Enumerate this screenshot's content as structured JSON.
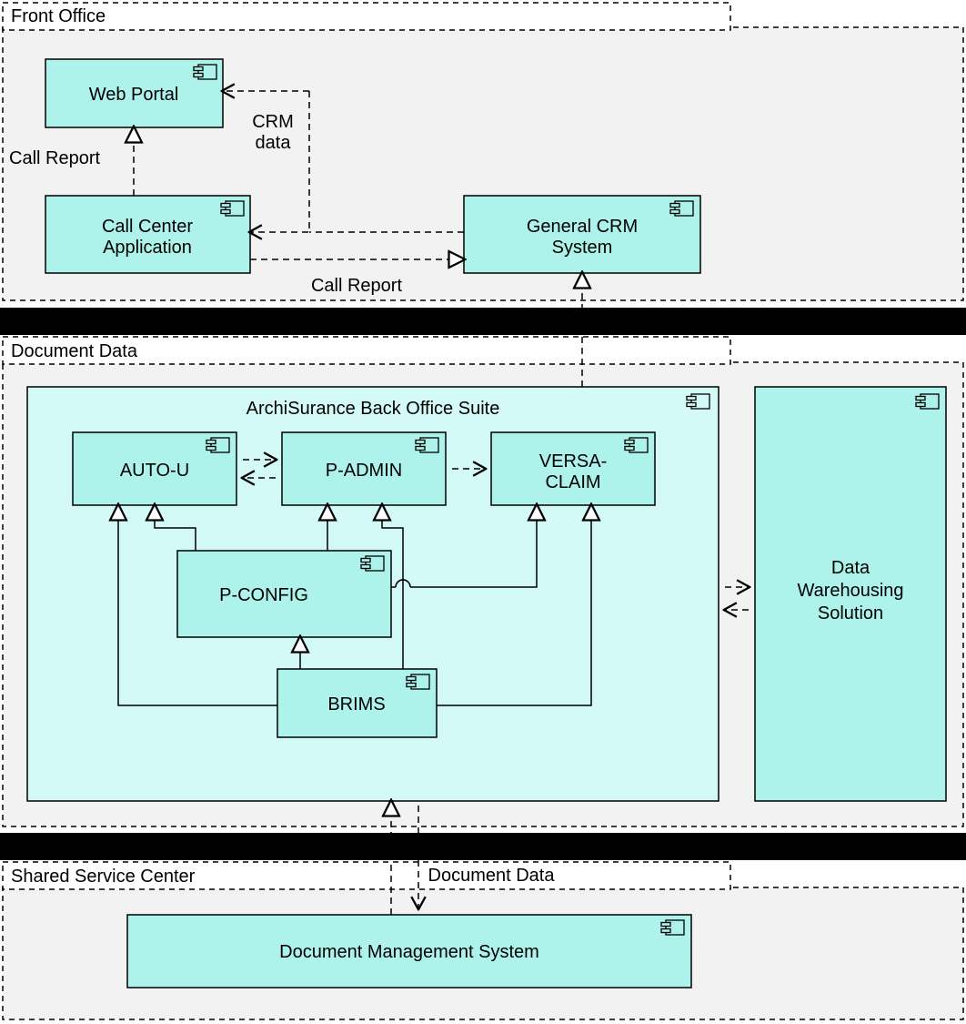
{
  "groups": {
    "front_office": "Front Office",
    "document_data": "Document Data",
    "shared_service_center": "Shared Service Center"
  },
  "components": {
    "web_portal": "Web Portal",
    "call_center_app_l1": "Call Center",
    "call_center_app_l2": "Application",
    "general_crm_l1": "General CRM",
    "general_crm_l2": "System",
    "back_office_suite": "ArchiSurance Back Office Suite",
    "auto_u": "AUTO-U",
    "p_admin": "P-ADMIN",
    "versa_claim_l1": "VERSA-",
    "versa_claim_l2": "CLAIM",
    "p_config": "P-CONFIG",
    "brims": "BRIMS",
    "data_warehousing_l1": "Data",
    "data_warehousing_l2": "Warehousing",
    "data_warehousing_l3": "Solution",
    "dms": "Document Management System"
  },
  "edges": {
    "crm_data_l1": "CRM",
    "crm_data_l2": "data",
    "call_report": "Call Report",
    "document_data": "Document Data"
  }
}
